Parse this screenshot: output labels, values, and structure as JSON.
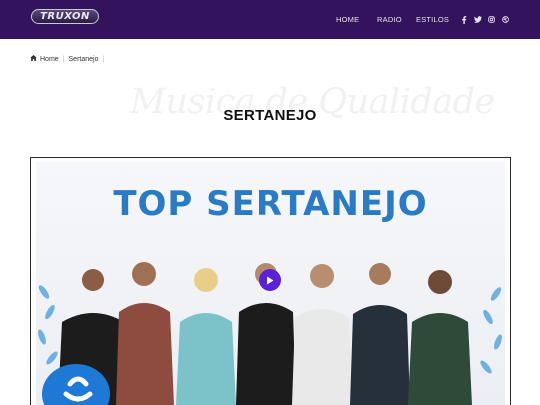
{
  "header": {
    "logo_text": "TRUXON",
    "nav": [
      "HOME",
      "RADIO",
      "ESTILOS"
    ],
    "social_icons": [
      "facebook-icon",
      "twitter-icon",
      "instagram-icon",
      "dribbble-icon"
    ],
    "background_color": "#33135c"
  },
  "breadcrumb": {
    "items": [
      "Home",
      "Sertanejo"
    ]
  },
  "page": {
    "watermark_text": "Musica de Qualidade",
    "title": "SERTANEJO"
  },
  "banner": {
    "heading": "TOP SERTANEJO",
    "heading_color": "#2a7bc6",
    "play_button_color": "#5a22d6"
  }
}
